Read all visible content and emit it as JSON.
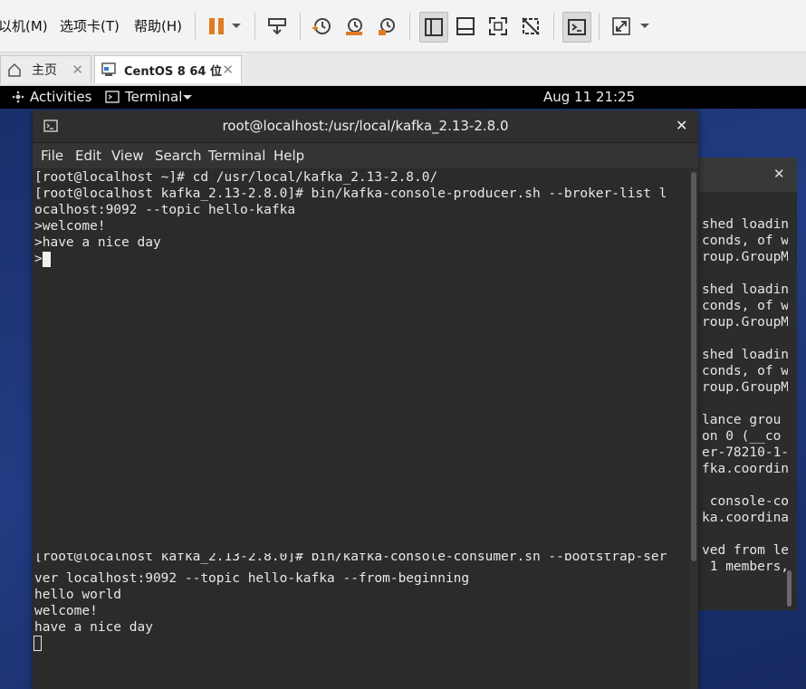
{
  "vmware": {
    "menu": [
      "以机(M)",
      "选项卡(T)",
      "帮助(H)"
    ],
    "tabs": [
      {
        "label": "主页"
      },
      {
        "label": "CentOS 8 64 位"
      }
    ]
  },
  "gnome": {
    "activities": "Activities",
    "app_menu": "Terminal",
    "clock": "Aug 11  21:25"
  },
  "terminal": {
    "title": "root@localhost:/usr/local/kafka_2.13-2.8.0",
    "menu": [
      "File",
      "Edit",
      "View",
      "Search",
      "Terminal",
      "Help"
    ],
    "producer_lines": [
      "[root@localhost ~]# cd /usr/local/kafka_2.13-2.8.0/",
      "[root@localhost kafka_2.13-2.8.0]# bin/kafka-console-producer.sh --broker-list l",
      "ocalhost:9092 --topic hello-kafka",
      ">welcome!",
      ">have a nice day",
      ">"
    ],
    "consumer_lines": [
      "[root@localhost kafka_2.13-2.8.0]# bin/kafka-console-consumer.sh --bootstrap-ser",
      "ver localhost:9092 --topic hello-kafka --from-beginning",
      "hello world",
      "welcome!",
      "have a nice day"
    ]
  },
  "back_terminal": {
    "lines": [
      "shed loadin",
      "conds, of w",
      "roup.GroupM",
      "",
      "shed loadin",
      "conds, of w",
      "roup.GroupM",
      "",
      "shed loadin",
      "conds, of w",
      "roup.GroupM",
      "",
      "lance grou",
      "on 0 (__co",
      "er-78210-1-",
      "fka.coordin",
      "",
      " console-co",
      "ka.coordina",
      "",
      "ved from le",
      " 1 members,"
    ]
  },
  "colors": {
    "terminal_bg": "#2b2b2b",
    "desktop": "#1f3475",
    "pause_accent": "#e07b22"
  }
}
